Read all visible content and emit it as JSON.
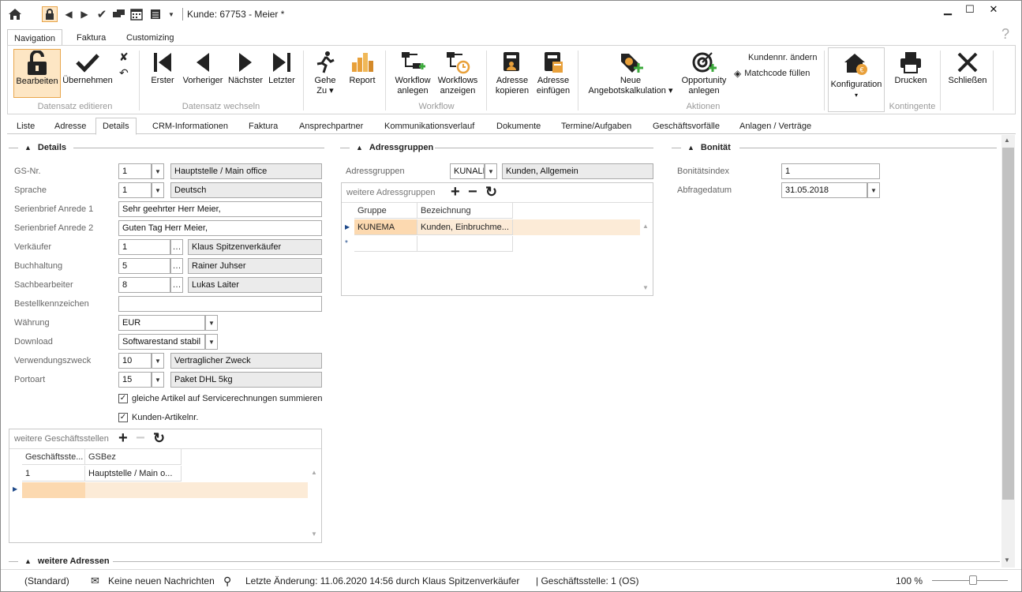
{
  "window": {
    "title": "Kunde: 67753 - Meier *"
  },
  "ribbon_tabs": [
    "Navigation",
    "Faktura",
    "Customizing"
  ],
  "ribbon": {
    "bearbeiten": "Bearbeiten",
    "uebernehmen": "Übernehmen",
    "group_datensatz_edit": "Datensatz editieren",
    "erster": "Erster",
    "vorheriger": "Vorheriger",
    "naechster": "Nächster",
    "letzter": "Letzter",
    "group_datensatz_wechseln": "Datensatz wechseln",
    "gehe_zu_1": "Gehe",
    "gehe_zu_2": "Zu ▾",
    "report": "Report",
    "workflow_anlegen_1": "Workflow",
    "workflow_anlegen_2": "anlegen",
    "workflows_anzeigen_1": "Workflows",
    "workflows_anzeigen_2": "anzeigen",
    "group_workflow": "Workflow",
    "adresse_kopieren_1": "Adresse",
    "adresse_kopieren_2": "kopieren",
    "adresse_einfuegen_1": "Adresse",
    "adresse_einfuegen_2": "einfügen",
    "neue_angebot_1": "Neue",
    "neue_angebot_2": "Angebotskalkulation ▾",
    "opportunity_1": "Opportunity",
    "opportunity_2": "anlegen",
    "kundennr_aendern": "Kundennr. ändern",
    "matchcode_fuellen": "Matchcode füllen",
    "group_aktionen": "Aktionen",
    "konfiguration": "Konfiguration",
    "konfiguration_arrow": "▾",
    "group_kontingente": "Kontingente",
    "drucken": "Drucken",
    "schliessen": "Schließen"
  },
  "tabs": [
    "Liste",
    "Adresse",
    "Details",
    "CRM-Informationen",
    "Faktura",
    "Ansprechpartner",
    "Kommunikationsverlauf",
    "Dokumente",
    "Termine/Aufgaben",
    "Geschäftsvorfälle",
    "Anlagen / Verträge"
  ],
  "details": {
    "heading": "Details",
    "gs_nr_label": "GS-Nr.",
    "gs_nr": "1",
    "gs_nr_text": "Hauptstelle / Main office",
    "sprache_label": "Sprache",
    "sprache": "1",
    "sprache_text": "Deutsch",
    "anrede1_label": "Serienbrief Anrede 1",
    "anrede1": "Sehr geehrter Herr Meier,",
    "anrede2_label": "Serienbrief Anrede 2",
    "anrede2": "Guten Tag Herr Meier,",
    "verkaeufer_label": "Verkäufer",
    "verkaeufer": "1",
    "verkaeufer_text": "Klaus Spitzenverkäufer",
    "buchhaltung_label": "Buchhaltung",
    "buchhaltung": "5",
    "buchhaltung_text": "Rainer Juhser",
    "sachbearbeiter_label": "Sachbearbeiter",
    "sachbearbeiter": "8",
    "sachbearbeiter_text": "Lukas Laiter",
    "bestellkennzeichen_label": "Bestellkennzeichen",
    "bestellkennzeichen": "",
    "waehrung_label": "Währung",
    "waehrung": "EUR",
    "download_label": "Download",
    "download": "Softwarestand stabil",
    "verwendungszweck_label": "Verwendungszweck",
    "verwendungszweck": "10",
    "verwendungszweck_text": "Vertraglicher Zweck",
    "portoart_label": "Portoart",
    "portoart": "15",
    "portoart_text": "Paket DHL 5kg",
    "chk_gleiche": "gleiche Artikel auf Servicerechnungen summieren",
    "chk_kunden": "Kunden-Artikelnr."
  },
  "geschaeftsstellen": {
    "title": "weitere Geschäftsstellen",
    "col1": "Geschäftsste...",
    "col2": "GSBez",
    "rows": [
      {
        "c1": "1",
        "c2": "Hauptstelle / Main o..."
      }
    ]
  },
  "adressgruppen": {
    "heading": "Adressgruppen",
    "label": "Adressgruppen",
    "value": "KUNALL",
    "text": "Kunden, Allgemein",
    "weitere_title": "weitere Adressgruppen",
    "col1": "Gruppe",
    "col2": "Bezeichnung",
    "rows": [
      {
        "c1": "KUNEMA",
        "c2": "Kunden, Einbruchme..."
      }
    ]
  },
  "bonitaet": {
    "heading": "Bonität",
    "index_label": "Bonitätsindex",
    "index": "1",
    "datum_label": "Abfragedatum",
    "datum": "31.05.2018"
  },
  "weitere_adressen": {
    "heading": "weitere Adressen"
  },
  "statusbar": {
    "standard": "(Standard)",
    "messages": "Keine neuen Nachrichten",
    "last_change": "Letzte Änderung: 11.06.2020 14:56 durch Klaus Spitzenverkäufer",
    "gs": "| Geschäftsstelle: 1 (OS)",
    "zoom": "100 %",
    "zoom_level": 0.55
  }
}
